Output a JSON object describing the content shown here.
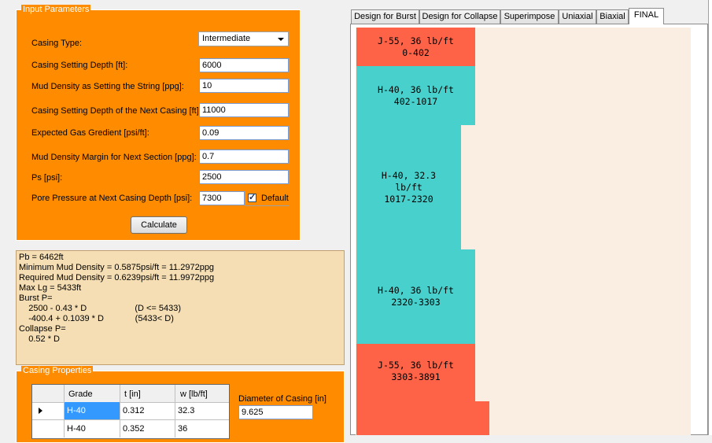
{
  "input_group": {
    "title": "Input Parameters",
    "fields": [
      {
        "label": "Casing Type:",
        "value": "Intermediate",
        "kind": "combo"
      },
      {
        "label": "Casing Setting Depth [ft]:",
        "value": "6000"
      },
      {
        "label": "Mud Density as Setting the String [ppg]:",
        "value": "10"
      },
      {
        "label": "Casing Setting Depth of the Next Casing [ft]:",
        "value": "11000"
      },
      {
        "label": "Expected Gas Gredient [psi/ft]:",
        "value": "0.09"
      },
      {
        "label": "Mud Density Margin for Next Section [ppg]:",
        "value": "0.7"
      },
      {
        "label": "Ps [psi]:",
        "value": "2500"
      },
      {
        "label": "Pore Pressure at Next Casing Depth  [psi]:",
        "value": "7300"
      }
    ],
    "default_label": "Default",
    "default_checked": true,
    "calculate_label": "Calculate"
  },
  "results": [
    "Pb = 6462ft",
    "Minimum Mud Density = 0.5875psi/ft = 11.2972ppg",
    "Required Mud Density = 0.6239psi/ft = 11.9972ppg",
    "Max Lg = 5433ft",
    "Burst P=",
    "    2500 - 0.43 * D                    (D <= 5433)",
    "    -400.4 + 0.1039 * D             (5433< D)",
    "Collapse P=",
    "    0.52 * D"
  ],
  "casing_props": {
    "title": "Casing Properties",
    "columns": [
      "Grade",
      "t [in]",
      "w [lb/ft]"
    ],
    "rows": [
      [
        "H-40",
        "0.312",
        "32.3"
      ],
      [
        "H-40",
        "0.352",
        "36"
      ]
    ],
    "diameter_label": "Diameter of Casing [in]",
    "diameter_value": "9.625"
  },
  "tabs": [
    "Design for Burst",
    "Design for Collapse",
    "Superimpose",
    "Uniaxial",
    "Biaxial",
    "FINAL"
  ],
  "active_tab": "FINAL",
  "segments": [
    {
      "text": "J-55, 36 lb/ft\n0-402",
      "color": "#ff6347"
    },
    {
      "text": "H-40, 36 lb/ft\n402-1017",
      "color": "#48d1cc"
    },
    {
      "text": "H-40, 32.3\nlb/ft\n1017-2320",
      "color": "#48d1cc"
    },
    {
      "text": "H-40, 36 lb/ft\n2320-3303",
      "color": "#48d1cc"
    },
    {
      "text": "J-55, 36 lb/ft\n3303-3891",
      "color": "#ff6347"
    },
    {
      "text": "",
      "color": "#ff6347"
    }
  ]
}
